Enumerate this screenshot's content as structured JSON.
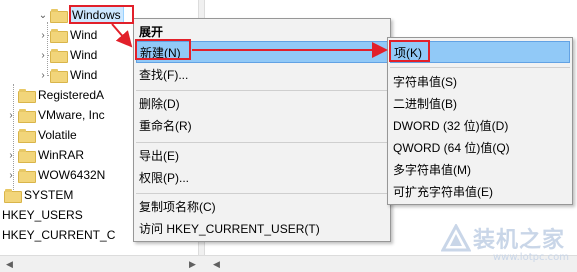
{
  "tree": {
    "nodes": [
      {
        "label": "Windows",
        "selected": true
      },
      {
        "label": "Wind"
      },
      {
        "label": "Wind"
      },
      {
        "label": "Wind"
      },
      {
        "label": "RegisteredA"
      },
      {
        "label": "VMware, Inc"
      },
      {
        "label": "Volatile"
      },
      {
        "label": "WinRAR"
      },
      {
        "label": "WOW6432N"
      },
      {
        "label": "SYSTEM"
      },
      {
        "label": "HKEY_USERS"
      },
      {
        "label": "HKEY_CURRENT_C"
      }
    ]
  },
  "context_menu": {
    "expand": "展开",
    "new": "新建(N)",
    "find": "查找(F)...",
    "delete": "删除(D)",
    "rename": "重命名(R)",
    "export": "导出(E)",
    "permissions": "权限(P)...",
    "copy_key_name": "复制项名称(C)",
    "visit": "访问 HKEY_CURRENT_USER(T)"
  },
  "submenu": {
    "key": "项(K)",
    "string_value": "字符串值(S)",
    "binary_value": "二进制值(B)",
    "dword_value": "DWORD (32 位)值(D)",
    "qword_value": "QWORD (64 位)值(Q)",
    "multi_string_value": "多字符串值(M)",
    "expandable_string_value": "可扩充字符串值(E)"
  },
  "watermark": {
    "name": "装机之家",
    "url": "www.lotpc.com"
  },
  "colors": {
    "highlight": "#91c9f7",
    "annotation": "#e2202a"
  }
}
